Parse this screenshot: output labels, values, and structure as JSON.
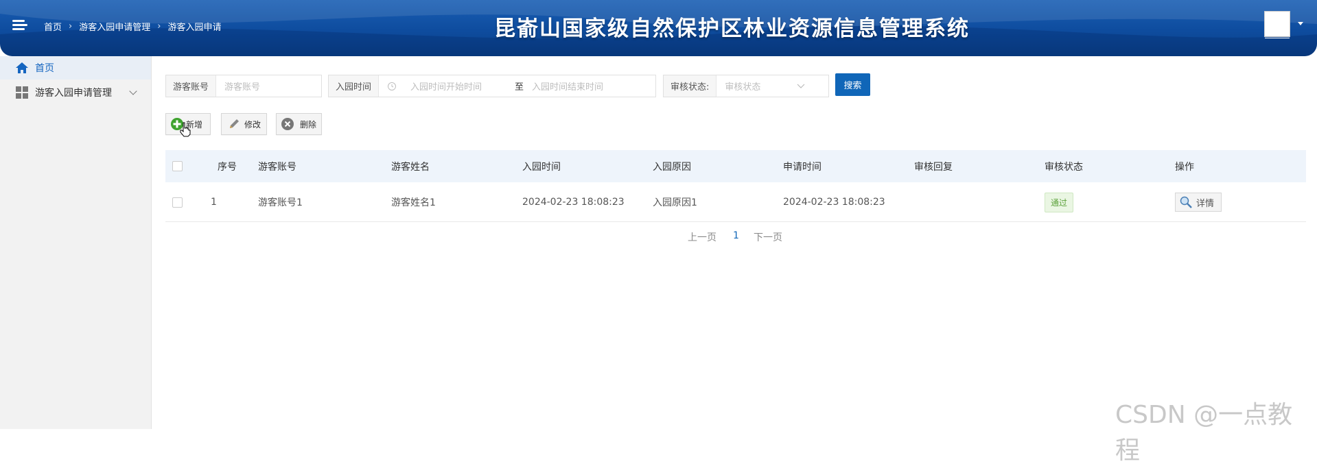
{
  "header": {
    "breadcrumb": [
      "首页",
      "游客入园申请管理",
      "游客入园申请"
    ],
    "title": "昆嵛山国家级自然保护区林业资源信息管理系统"
  },
  "sidebar": {
    "home": "首页",
    "mgmt": "游客入园申请管理"
  },
  "search": {
    "account_label": "游客账号",
    "account_placeholder": "游客账号",
    "time_label": "入园时间",
    "time_start_placeholder": "入园时间开始时间",
    "time_to": "至",
    "time_end_placeholder": "入园时间结束时间",
    "status_label": "审核状态:",
    "status_placeholder": "审核状态",
    "search_button": "搜索"
  },
  "toolbar": {
    "add": "新增",
    "edit": "修改",
    "delete": "删除"
  },
  "table": {
    "columns": [
      "序号",
      "游客账号",
      "游客姓名",
      "入园时间",
      "入园原因",
      "申请时间",
      "审核回复",
      "审核状态",
      "操作"
    ],
    "rows": [
      {
        "index": "1",
        "account": "游客账号1",
        "name": "游客姓名1",
        "entry_time": "2024-02-23 18:08:23",
        "reason": "入园原因1",
        "apply_time": "2024-02-23 18:08:23",
        "reply": "",
        "status": "通过",
        "action": "详情"
      }
    ]
  },
  "pager": {
    "prev": "上一页",
    "current": "1",
    "next": "下一页"
  },
  "watermark": "CSDN @一点教程",
  "colors": {
    "header_blue": "#0e4c9e",
    "primary": "#1066b8",
    "status_green": "#5ba13a"
  }
}
